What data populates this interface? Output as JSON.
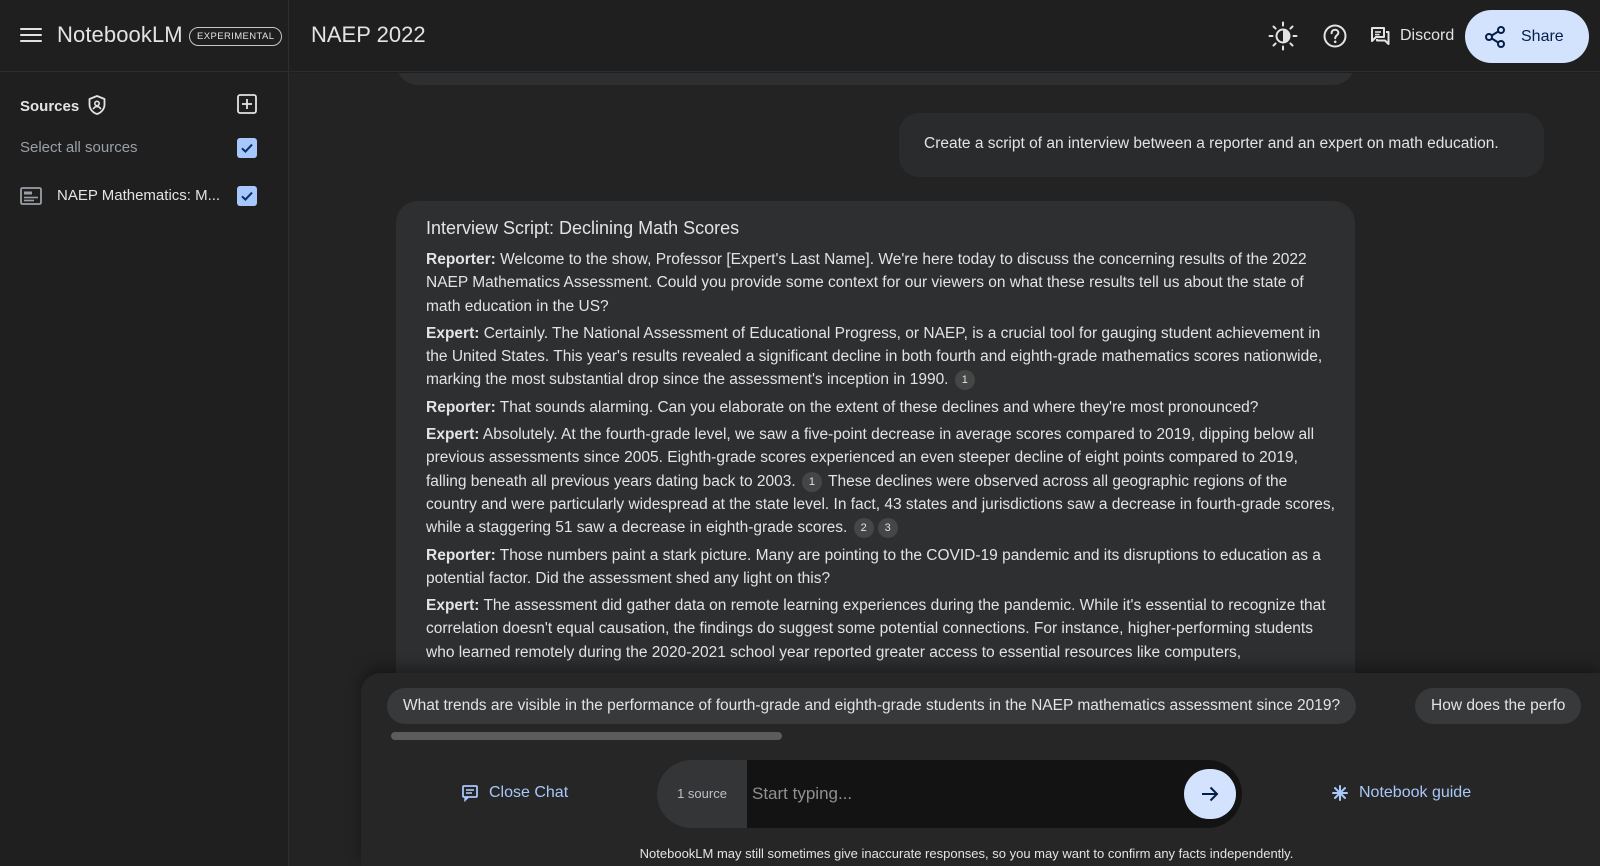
{
  "app": {
    "name": "NotebookLM",
    "badge": "EXPERIMENTAL",
    "notebook_title": "NAEP 2022"
  },
  "header": {
    "theme_icon": "brightness-icon",
    "help_icon": "help-circle-icon",
    "discord_label": "Discord",
    "share_label": "Share"
  },
  "sidebar": {
    "title": "Sources",
    "select_all_label": "Select all sources",
    "select_all_checked": true,
    "sources": [
      {
        "label": "NAEP Mathematics: M...",
        "checked": true
      }
    ]
  },
  "chat": {
    "user_message": "Create a script of an interview between a reporter and an expert on math education.",
    "answer": {
      "title": "Interview Script: Declining Math Scores",
      "paragraphs": [
        {
          "speaker": "Reporter:",
          "text": "Welcome to the show, Professor [Expert's Last Name]. We're here today to discuss the concerning results of the 2022 NAEP Mathematics Assessment. Could you provide some context for our viewers on what these results tell us about the state of math education in the US?"
        },
        {
          "speaker": "Expert:",
          "text": "Certainly. The National Assessment of Educational Progress, or NAEP, is a crucial tool for gauging student achievement in the United States. This year's results revealed a significant decline in both fourth and eighth-grade mathematics scores nationwide, marking the most substantial drop since the assessment's inception in 1990.",
          "cite": "1"
        },
        {
          "speaker": "Reporter:",
          "text": "That sounds alarming. Can you elaborate on the extent of these declines and where they're most pronounced?"
        },
        {
          "speaker": "Expert:",
          "text_a": "Absolutely. At the fourth-grade level, we saw a five-point decrease in average scores compared to 2019, dipping below all previous assessments since 2005. Eighth-grade scores experienced an even steeper decline of eight points compared to 2019, falling beneath all previous years dating back to 2003.",
          "cite_a": "1",
          "text_b": "These declines were observed across all geographic regions of the country and were particularly widespread at the state level. In fact, 43 states and jurisdictions saw a decrease in fourth-grade scores, while a staggering 51 saw a decrease in eighth-grade scores.",
          "cite_b1": "2",
          "cite_b2": "3"
        },
        {
          "speaker": "Reporter:",
          "text": "Those numbers paint a stark picture. Many are pointing to the COVID-19 pandemic and its disruptions to education as a potential factor. Did the assessment shed any light on this?"
        },
        {
          "speaker": "Expert:",
          "text": "The assessment did gather data on remote learning experiences during the pandemic. While it's essential to recognize that correlation doesn't equal causation, the findings do suggest some potential connections. For instance, higher-performing students who learned remotely during the 2020-2021 school year reported greater access to essential resources like computers,"
        }
      ]
    }
  },
  "suggestions": [
    "What trends are visible in the performance of fourth-grade and eighth-grade students in the NAEP mathematics assessment since 2019?",
    "How does the perfo"
  ],
  "composer": {
    "close_chat_label": "Close Chat",
    "source_count": "1 source",
    "placeholder": "Start typing...",
    "guide_label": "Notebook guide",
    "disclaimer": "NotebookLM may still sometimes give inaccurate responses, so you may want to confirm any facts independently."
  },
  "colors": {
    "background": "#1f1f1f",
    "accent": "#a8c7fa",
    "share_bg": "#d3e3fd"
  }
}
